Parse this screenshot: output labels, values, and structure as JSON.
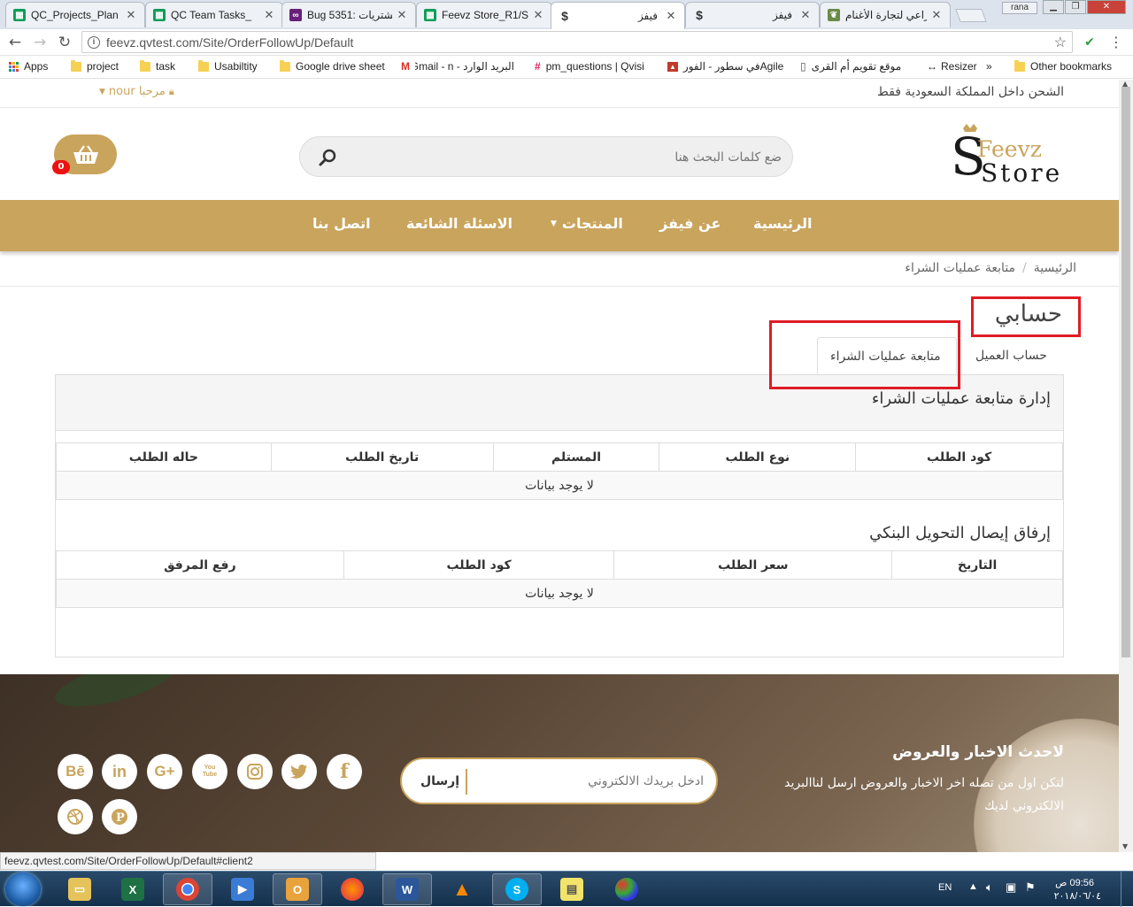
{
  "browser": {
    "tabs": [
      {
        "title": "QC_Projects_Plan",
        "icon": "sheets-icon",
        "color": "#0f9d58"
      },
      {
        "title": "QC Team Tasks_",
        "icon": "sheets-icon",
        "color": "#0f9d58"
      },
      {
        "title": "Bug 5351: مشتريات",
        "icon": "visualstudio-icon",
        "color": "#68217a"
      },
      {
        "title": "Feevz Store_R1/S",
        "icon": "sheets-icon",
        "color": "#0f9d58"
      },
      {
        "title": "فيفز",
        "icon": "dollar-icon",
        "color": "#555555"
      },
      {
        "title": "فيفز",
        "icon": "dollar-icon",
        "color": "#555555"
      },
      {
        "title": "الراعي لتجارة الأغنام",
        "icon": "leaf-icon",
        "color": "#6a8a4a"
      }
    ],
    "user_label": "rana",
    "url": "feevz.qvtest.com/Site/OrderFollowUp/Default",
    "bookmarks": [
      "Apps",
      "project",
      "task",
      "Usabiltity",
      "Google drive sheet",
      "البريد الوارد - Gmail - n",
      "pm_questions | Qvisi",
      "Agileفي سطور - الفور",
      "موقع تقويم أم القرى",
      "Resizer",
      "»",
      "Other bookmarks"
    ],
    "status_url": "feevz.qvtest.com/Site/OrderFollowUp/Default#client2"
  },
  "site": {
    "shipping_notice": "الشحن داخل المملكة السعودية فقط",
    "welcome": "مرحبا nour",
    "logo_top": "Feevz",
    "logo_bottom": "Store",
    "logo_s": "S",
    "search_placeholder": "ضع كلمات البحث هنا",
    "cart_count": "0",
    "nav": [
      "الرئيسية",
      "عن فيفز",
      "المنتجات",
      "الاسئلة الشائعة",
      "اتصل بنا"
    ],
    "breadcrumb": [
      "الرئيسية",
      "متابعة عمليات الشراء"
    ],
    "breadcrumb_sep": "/",
    "page_title": "حسابي",
    "tabs": [
      "حساب العميل",
      "متابعة عمليات الشراء"
    ],
    "section1_title": "إدارة متابعة عمليات الشراء",
    "table1": {
      "headers": [
        "كود الطلب",
        "نوع الطلب",
        "المستلم",
        "تاريخ الطلب",
        "حاله الطلب"
      ],
      "empty": "لا يوجد بيانات"
    },
    "section2_title": "إرفاق إيصال التحويل البنكي",
    "table2": {
      "headers": [
        "التاريخ",
        "سعر الطلب",
        "كود الطلب",
        "رفع المرفق"
      ],
      "empty": "لا يوجد بيانات"
    },
    "footer": {
      "news_title": "لاحدث الاخبار والعروض",
      "news_desc": "لتكن اول من تصله اخر الاخبار والعروض ارسل لناالبريد الالكتروني لديك",
      "email_placeholder": "ادخل بريدك الالكتروني",
      "send_label": "إرسال",
      "social": [
        {
          "name": "behance-icon",
          "glyph": "Bē"
        },
        {
          "name": "linkedin-icon",
          "glyph": "in"
        },
        {
          "name": "googleplus-icon",
          "glyph": "G+"
        },
        {
          "name": "youtube-icon",
          "glyph": "You Tube"
        },
        {
          "name": "instagram-icon",
          "glyph": ""
        },
        {
          "name": "twitter-icon",
          "glyph": ""
        },
        {
          "name": "facebook-icon",
          "glyph": "f"
        },
        {
          "name": "dribbble-icon",
          "glyph": ""
        },
        {
          "name": "pinterest-icon",
          "glyph": "P"
        }
      ]
    }
  },
  "taskbar": {
    "lang": "EN",
    "time": "09:56 ص",
    "date": "٢٠١٨/٠٦/٠٤"
  },
  "colors": {
    "accent": "#c9a45c",
    "highlight": "#e01b24"
  }
}
